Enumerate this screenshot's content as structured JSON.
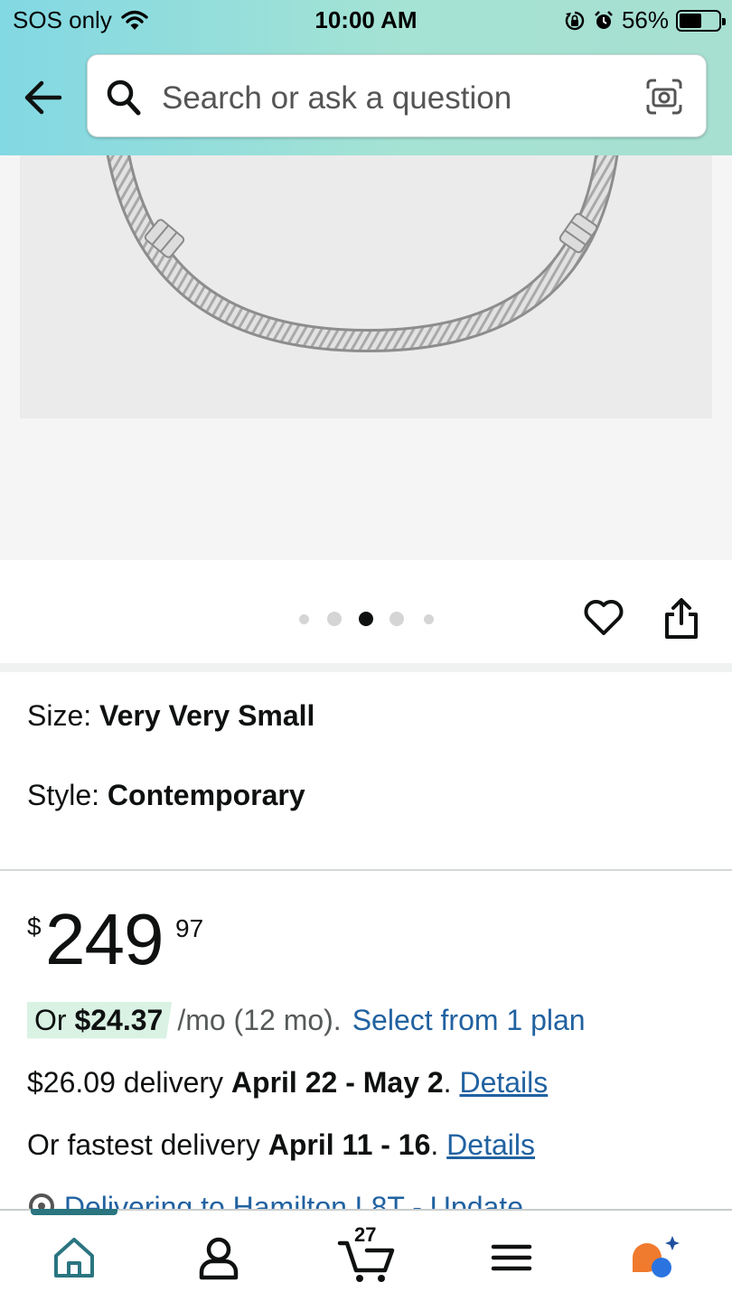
{
  "status_bar": {
    "carrier": "SOS only",
    "time": "10:00 AM",
    "battery": "56%",
    "battery_level": 0.56
  },
  "search": {
    "placeholder": "Search or ask a question"
  },
  "carousel": {
    "total_dots": 5,
    "active_index": 2
  },
  "variations": {
    "size_label": "Size:",
    "size_value": "Very Very Small",
    "style_label": "Style:",
    "style_value": "Contemporary"
  },
  "price": {
    "currency": "$",
    "whole": "249",
    "fraction": "97"
  },
  "installment": {
    "prefix": "Or",
    "amount": "$24.37",
    "term": "/mo (12 mo).",
    "link": "Select from 1 plan"
  },
  "delivery": {
    "standard_text": "$26.09 delivery",
    "standard_dates": "April 22 - May 2",
    "standard_link": "Details",
    "fastest_text": "Or fastest delivery",
    "fastest_dates": "April 11 - 16",
    "fastest_link": "Details",
    "deliver_to": "Delivering to Hamilton L8T - Update"
  },
  "bottom_nav": {
    "cart_count": "27",
    "items": [
      "home-icon",
      "account-icon",
      "cart-icon",
      "menu-icon",
      "rufus-icon"
    ]
  },
  "colors": {
    "header_start": "#82d8e3",
    "header_end": "#a7dfd0",
    "link": "#2162a1",
    "installment_highlight": "#d9f2e4",
    "nav_active": "#2a7580",
    "rufus_orange": "#f07a2d",
    "rufus_blue": "#2b74e0"
  }
}
